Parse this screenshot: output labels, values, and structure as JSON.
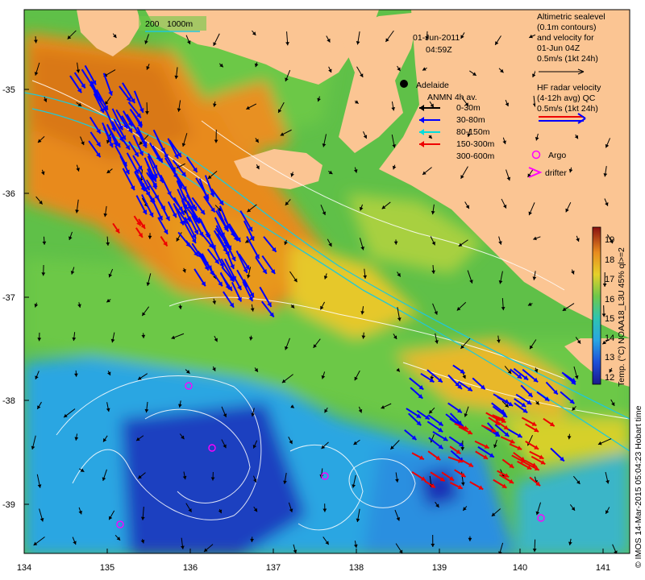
{
  "header": {
    "date": "01-Jun-2011",
    "time": "04:59Z"
  },
  "place": "Adelaide",
  "contour_labels": [
    "200",
    "1000m"
  ],
  "altimetry_legend": [
    "Altimetric sealevel",
    "(0.1m contours)",
    "and velocity for",
    "01-Jun 04Z",
    "0.5m/s (1kt 24h)"
  ],
  "hf_legend": [
    "HF radar velocity",
    "(4-12h avg) QC",
    "0.5m/s (1kt 24h)"
  ],
  "anmn_legend": {
    "title": "ANMN 4h av.",
    "items": [
      {
        "label": "0-30m",
        "color": "#000000"
      },
      {
        "label": "30-80m",
        "color": "#0000ff"
      },
      {
        "label": "80-150m",
        "color": "#00dddd"
      },
      {
        "label": "150-300m",
        "color": "#ee0000"
      },
      {
        "label": "300-600m",
        "color": "#000000"
      }
    ]
  },
  "markers": {
    "argo": "Argo",
    "drifter": "drifter"
  },
  "colorbar": {
    "ticks": [
      "19",
      "18",
      "17",
      "16",
      "15",
      "14",
      "13",
      "12"
    ],
    "label": "Temp. (°C) NOAA18_L3U 45% ql>=2"
  },
  "credit": "© IMOS 14-Mar-2015 05:04:23 Hobart time",
  "x_ticks": [
    "134",
    "135",
    "136",
    "137",
    "138",
    "139",
    "140",
    "141"
  ],
  "y_ticks": [
    "-35",
    "-36",
    "-37",
    "-38",
    "-39"
  ],
  "colors": {
    "land": "#fbc593",
    "ocean_warm": "#e88a1e",
    "ocean_mid": "#6fc84a",
    "ocean_cool": "#2aa6e2",
    "ocean_cold": "#1a2fb5"
  },
  "map_layer": "sea-surface-temperature"
}
